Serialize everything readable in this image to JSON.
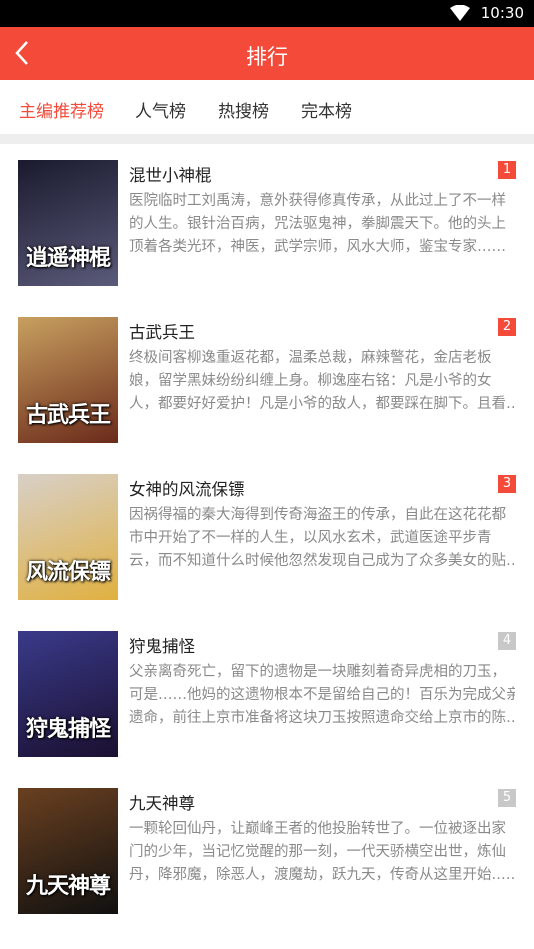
{
  "status_bar": {
    "time": "10:30"
  },
  "header": {
    "title": "排行"
  },
  "tabs": [
    {
      "label": "主编推荐榜",
      "active": true
    },
    {
      "label": "人气榜",
      "active": false
    },
    {
      "label": "热搜榜",
      "active": false
    },
    {
      "label": "完本榜",
      "active": false
    }
  ],
  "books": [
    {
      "rank": "1",
      "rank_color": "#f34a3a",
      "title": "混世小神棍",
      "cover_text": "逍遥神棍",
      "cover_colors": [
        "#1a1a2e",
        "#5a5a7a"
      ],
      "description_lines": [
        "医院临时工刘禹涛，意外获得修真传承，从此过上了不一样",
        "的人生。银针治百病，咒法驱鬼神，拳脚震天下。他的头上",
        "顶着各类光环，神医，武学宗师，风水大师，鉴宝专家……"
      ]
    },
    {
      "rank": "2",
      "rank_color": "#f34a3a",
      "title": "古武兵王",
      "cover_text": "古武兵王",
      "cover_colors": [
        "#c8a060",
        "#6b2a1a"
      ],
      "description_lines": [
        "终极间客柳逸重返花都，温柔总裁，麻辣警花，金店老板",
        "娘，留学黑妹纷纷纠缠上身。柳逸座右铭：凡是小爷的女",
        "人，都要好好爱护！凡是小爷的敌人，都要踩在脚下。且看…"
      ]
    },
    {
      "rank": "3",
      "rank_color": "#f34a3a",
      "title": "女神的风流保镖",
      "cover_text": "风流保镖",
      "cover_colors": [
        "#d8d0c8",
        "#e0b040"
      ],
      "description_lines": [
        "因祸得福的秦大海得到传奇海盗王的传承，自此在这花花都",
        "市中开始了不一样的人生，以风水玄术，武道医途平步青",
        "云，而不知道什么时候他忽然发现自己成为了众多美女的贴…"
      ]
    },
    {
      "rank": "4",
      "rank_color": "#c8c8c8",
      "title": "狩鬼捕怪",
      "cover_text": "狩鬼捕怪",
      "cover_colors": [
        "#3a3a8a",
        "#1a1030"
      ],
      "description_lines": [
        "父亲离奇死亡，留下的遗物是一块雕刻着奇异虎相的刀玉，",
        "可是……他妈的这遗物根本不是留给自己的！百乐为完成父亲",
        "遗命，前往上京市准备将这块刀玉按照遗命交给上京市的陈…"
      ]
    },
    {
      "rank": "5",
      "rank_color": "#c8c8c8",
      "title": "九天神尊",
      "cover_text": "九天神尊",
      "cover_colors": [
        "#6a4020",
        "#101010"
      ],
      "description_lines": [
        "一颗轮回仙丹，让巅峰王者的他投胎转世了。一位被逐出家",
        "门的少年，当记忆觉醒的那一刻，一代天骄横空出世，炼仙",
        "丹，降邪魔，除恶人，渡魔劫，跃九天，传奇从这里开始.…."
      ]
    }
  ]
}
